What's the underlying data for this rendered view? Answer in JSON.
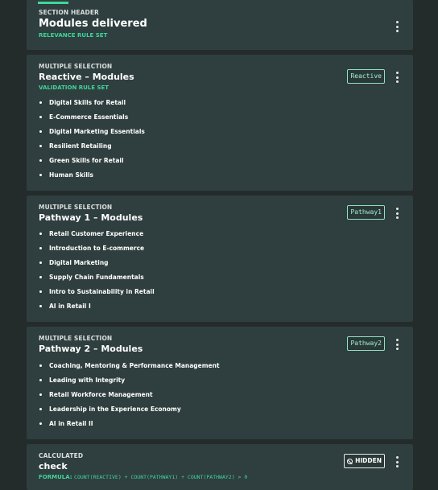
{
  "section_header": {
    "type": "SECTION HEADER",
    "title": "Modules delivered",
    "ruleset": "RELEVANCE RULE SET"
  },
  "reactive": {
    "type": "MULTIPLE SELECTION",
    "title": "Reactive – Modules",
    "ruleset": "VALIDATION RULE SET",
    "tag": "Reactive",
    "options": [
      "Digital Skills for Retail",
      "E-Commerce Essentials",
      "Digital Marketing Essentials",
      "Resilient Retailing",
      "Green Skills for Retail",
      "Human Skills"
    ]
  },
  "pathway1": {
    "type": "MULTIPLE SELECTION",
    "title": "Pathway 1 – Modules",
    "tag": "Pathway1",
    "options": [
      "Retail Customer Experience",
      "Introduction to E-commerce",
      "Digital Marketing",
      "Supply Chain Fundamentals",
      "Intro to Sustainability in Retail",
      "AI in Retail I"
    ]
  },
  "pathway2": {
    "type": "MULTIPLE SELECTION",
    "title": "Pathway 2 – Modules",
    "tag": "Pathway2",
    "options": [
      "Coaching, Mentoring & Performance Management",
      "Leading with Integrity",
      "Retail Workforce Management",
      "Leadership in the Experience Economy",
      "AI in Retail II"
    ]
  },
  "calculated": {
    "type": "CALCULATED",
    "title": "check",
    "badge": "HIDDEN",
    "formula_label": "FORMULA:",
    "formula": "COUNT(REACTIVE) + COUNT(PATHWAY1) + COUNT(PATHWAY2) > 0"
  },
  "colors": {
    "background": "#232b2b",
    "card": "#2f3e3e",
    "accent": "#3fd69b"
  },
  "icons": [
    "more-vertical-icon",
    "eye-off-icon"
  ]
}
